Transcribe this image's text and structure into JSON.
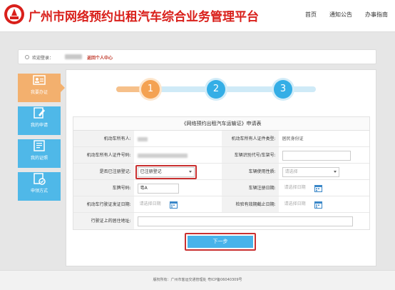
{
  "header": {
    "title": "广州市网络预约出租汽车综合业务管理平台",
    "nav": [
      "首页",
      "通知公告",
      "办事指南"
    ]
  },
  "welcome": {
    "text": "欢迎登录：",
    "personal_center": "返回个人中心"
  },
  "sidebar": {
    "items": [
      {
        "label": "我要办证",
        "icon": "id-card-icon",
        "active": true
      },
      {
        "label": "我的申请",
        "icon": "edit-document-icon",
        "active": false
      },
      {
        "label": "我的证照",
        "icon": "certificate-icon",
        "active": false
      },
      {
        "label": "申领方式",
        "icon": "form-check-icon",
        "active": false
      }
    ]
  },
  "steps": [
    "1",
    "2",
    "3"
  ],
  "form": {
    "title": "《网络预约出租汽车运输证》申请表",
    "owner_label": "机动车所有人:",
    "owner_id_type_label": "机动车所有人证件类型:",
    "owner_id_type_value": "居民身份证",
    "owner_id_no_label": "机动车所有人证件号码:",
    "vin_label": "车辆识别代号/车架号:",
    "registered_label": "是否已注册登记:",
    "registered_value": "已注册登记",
    "usage_label": "车辆使用性质:",
    "usage_placeholder": "请选择",
    "plate_label": "车牌号码:",
    "plate_value": "粤A",
    "reg_date_label": "车辆注册日期:",
    "reg_date_placeholder": "请选择日期",
    "license_date_label": "机动车行驶证发证日期:",
    "license_date_placeholder": "请选择日期",
    "inspection_label": "检验有效期截止日期:",
    "inspection_placeholder": "请选择日期",
    "address_label": "行驶证上的居住地址:",
    "next_button": "下一步"
  },
  "footer": {
    "text": "版权所有：广州市客运交通管理处    粤ICP备06040309号"
  },
  "colors": {
    "brand_red": "#d9201b",
    "sidebar_blue": "#4fb8e8",
    "sidebar_active": "#f3b06e",
    "button_blue": "#48b3ea",
    "highlight": "#c93030"
  }
}
